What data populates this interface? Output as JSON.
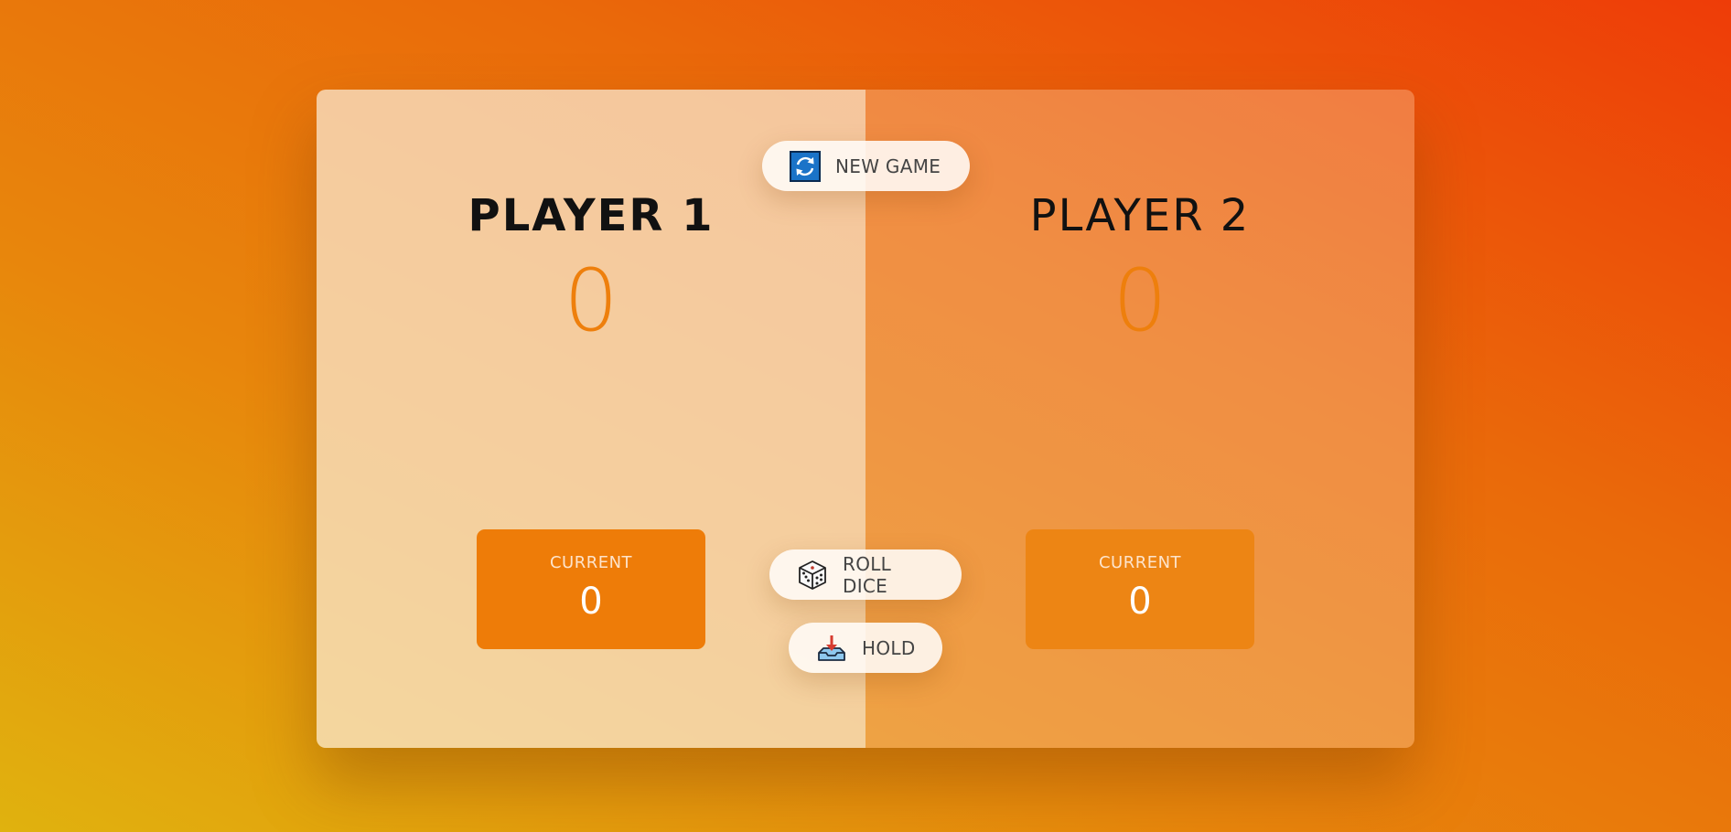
{
  "players": [
    {
      "name": "PLAYER 1",
      "score": "0",
      "current_label": "CURRENT",
      "current_score": "0",
      "active": true
    },
    {
      "name": "PLAYER 2",
      "score": "0",
      "current_label": "CURRENT",
      "current_score": "0",
      "active": false
    }
  ],
  "buttons": {
    "new_game": {
      "label": "NEW GAME",
      "icon": "refresh-icon"
    },
    "roll_dice": {
      "label": "ROLL DICE",
      "icon": "dice-icon"
    },
    "hold": {
      "label": "HOLD",
      "icon": "inbox-tray-icon"
    }
  },
  "colors": {
    "score": "#ee7f0c",
    "current_box": "#ee7c08",
    "background_gradient": [
      "#e0b20e",
      "#ee3c08"
    ]
  }
}
